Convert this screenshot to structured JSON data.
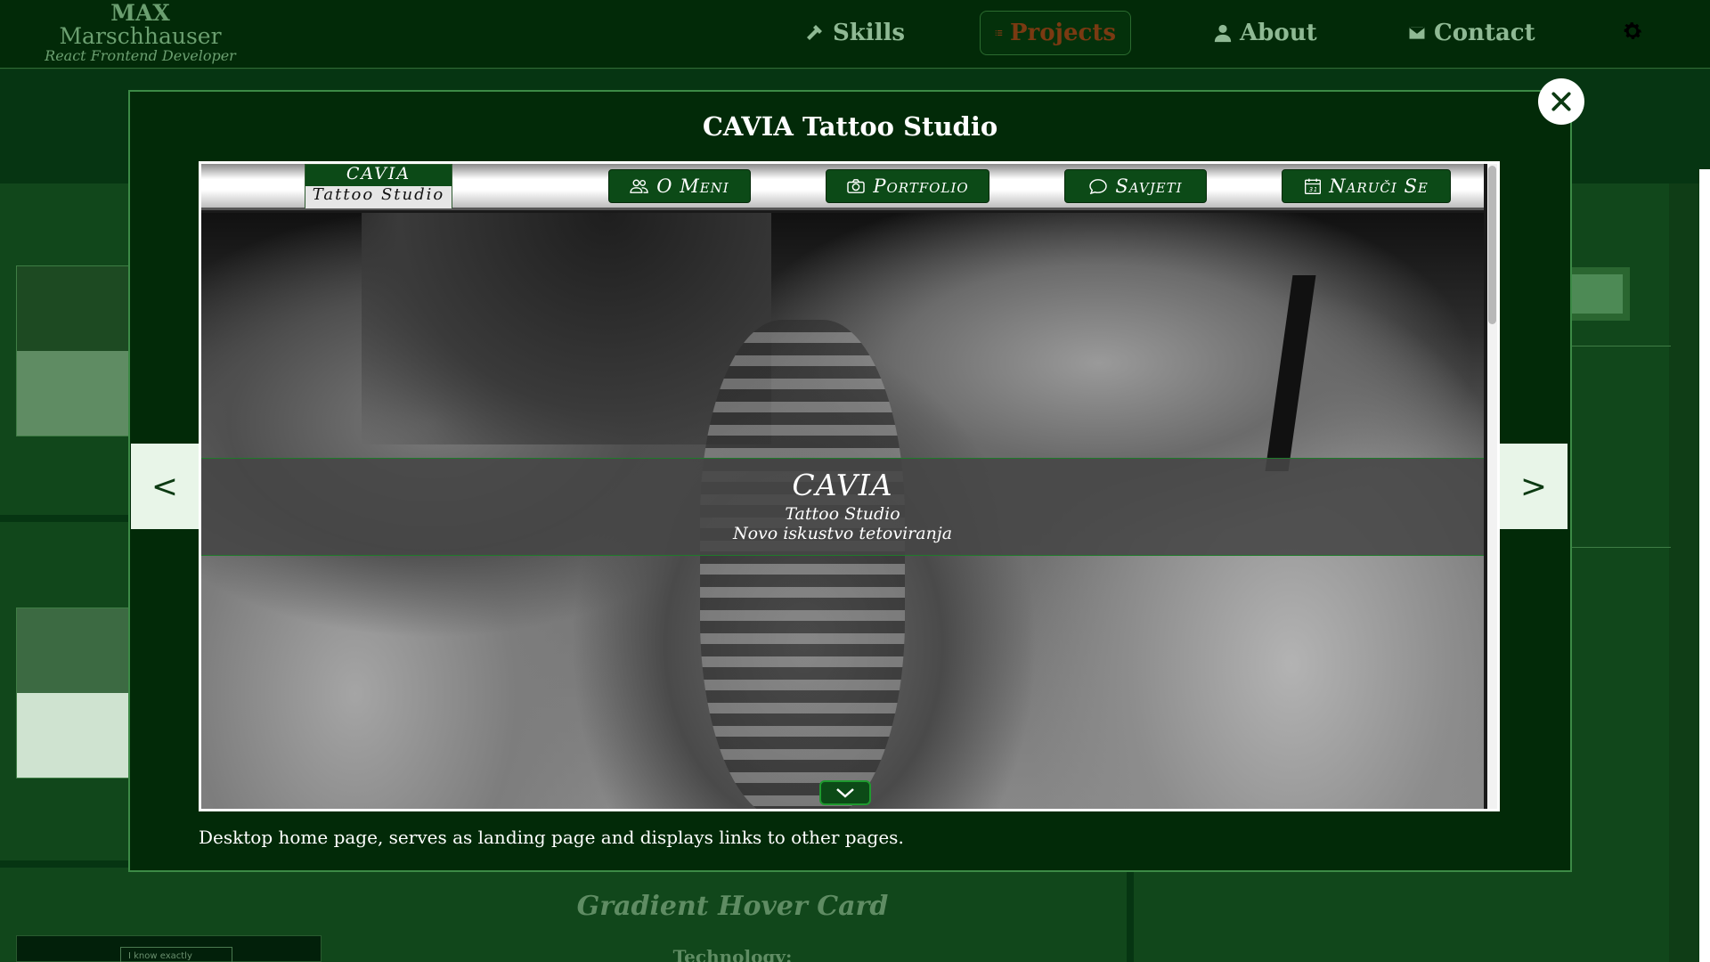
{
  "brand": {
    "first": "MAX",
    "last": "Marschhauser",
    "role": "React Frontend Developer"
  },
  "nav": {
    "items": [
      {
        "label": "Skills",
        "icon": "hammer-icon"
      },
      {
        "label": "Projects",
        "icon": "list-icon",
        "active": true
      },
      {
        "label": "About",
        "icon": "user-icon"
      },
      {
        "label": "Contact",
        "icon": "mail-icon"
      }
    ],
    "settings_icon": "gear-icon"
  },
  "modal": {
    "title": "CAVIA Tattoo Studio",
    "caption": "Desktop home page, serves as landing page and displays links to other pages.",
    "close_icon": "close-icon",
    "prev_label": "<",
    "next_label": ">"
  },
  "preview": {
    "logo": {
      "line1": "CAVIA",
      "line2": "Tattoo Studio"
    },
    "buttons": [
      {
        "label": "O Meni",
        "icon": "people-icon"
      },
      {
        "label": "Portfolio",
        "icon": "camera-icon"
      },
      {
        "label": "Savjeti",
        "icon": "chat-icon"
      },
      {
        "label": "Naruči Se",
        "icon": "calendar-icon"
      }
    ],
    "hero": {
      "title": "CAVIA",
      "subtitle": "Tattoo Studio",
      "tagline": "Novo iskustvo tetoviranja"
    },
    "scroll_icon": "chevron-down-icon"
  },
  "background": {
    "card_title": "Gradient Hover Card",
    "card_tech": "Technology:",
    "card_button": "I know exactly"
  },
  "colors": {
    "nav_bg": "#022a08",
    "page_bg": "#0f3d16",
    "accent": "#3c8a46",
    "active_nav_text": "#7a3a12",
    "preview_btn": "#0c4a17"
  }
}
